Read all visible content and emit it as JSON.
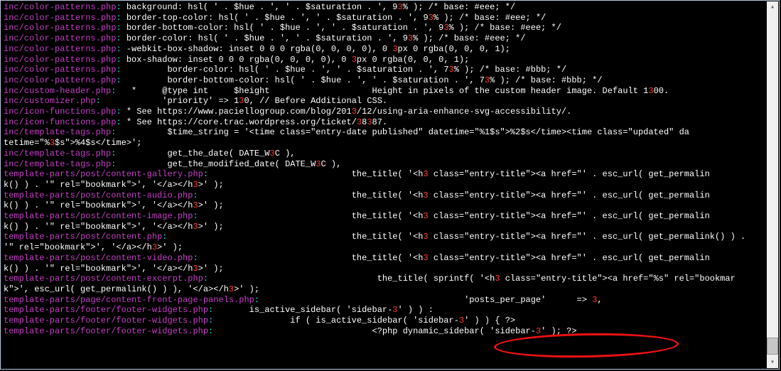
{
  "lines": [
    {
      "path": "inc/color-patterns.php",
      "segments": [
        {
          "t": " background: hsl( ' . $hue . ', ' . $saturation . ', 9"
        },
        {
          "t": "3",
          "h": true
        },
        {
          "t": "% ); /* base: #eee; */"
        }
      ]
    },
    {
      "path": "inc/color-patterns.php",
      "segments": [
        {
          "t": " border-top-color: hsl( ' . $hue . ', ' . $saturation . ', 9"
        },
        {
          "t": "3",
          "h": true
        },
        {
          "t": "% ); /* base: #eee; */"
        }
      ]
    },
    {
      "path": "inc/color-patterns.php",
      "segments": [
        {
          "t": " border-bottom-color: hsl( ' . $hue . ', ' . $saturation . ', 9"
        },
        {
          "t": "3",
          "h": true
        },
        {
          "t": "% ); /* base: #eee; */"
        }
      ]
    },
    {
      "path": "inc/color-patterns.php",
      "segments": [
        {
          "t": " border-color: hsl( ' . $hue . ', ' . $saturation . ', 9"
        },
        {
          "t": "3",
          "h": true
        },
        {
          "t": "% ); /* base: #eee; */"
        }
      ]
    },
    {
      "path": "inc/color-patterns.php",
      "segments": [
        {
          "t": " -webkit-box-shadow: inset 0 0 0 rgba(0, 0, 0, 0), 0 "
        },
        {
          "t": "3",
          "h": true
        },
        {
          "t": "px 0 rgba(0, 0, 0, 1);"
        }
      ]
    },
    {
      "path": "inc/color-patterns.php",
      "segments": [
        {
          "t": " box-shadow: inset 0 0 0 rgba(0, 0, 0, 0), 0 "
        },
        {
          "t": "3",
          "h": true
        },
        {
          "t": "px 0 rgba(0, 0, 0, 1);"
        }
      ]
    },
    {
      "path": "inc/color-patterns.php",
      "segments": [
        {
          "t": "         border-color: hsl( ' . $hue . ', ' . $saturation . ', 7"
        },
        {
          "t": "3",
          "h": true
        },
        {
          "t": "% ); /* base: #bbb; */"
        }
      ]
    },
    {
      "path": "inc/color-patterns.php",
      "segments": [
        {
          "t": "         border-bottom-color: hsl( ' . $hue . ', ' . $saturation . ', 7"
        },
        {
          "t": "3",
          "h": true
        },
        {
          "t": "% ); /* base: #bbb; */"
        }
      ]
    },
    {
      "path": "inc/custom-header.php",
      "segments": [
        {
          "t": "   *     @type int     $height                    Height in pixels of the custom header image. Default 1"
        },
        {
          "t": "3",
          "h": true
        },
        {
          "t": "00."
        }
      ]
    },
    {
      "path": "inc/customizer.php",
      "segments": [
        {
          "t": "            'priority' => 1"
        },
        {
          "t": "3",
          "h": true
        },
        {
          "t": "0, // Before Additional CSS."
        }
      ]
    },
    {
      "path": "inc/icon-functions.php",
      "segments": [
        {
          "t": " * See https://www.paciellogroup.com/blog/201"
        },
        {
          "t": "3",
          "h": true
        },
        {
          "t": "/12/using-aria-enhance-svg-accessibility/."
        }
      ]
    },
    {
      "path": "inc/icon-functions.php",
      "segments": [
        {
          "t": " * See https://core.trac.wordpress.org/ticket/"
        },
        {
          "t": "3",
          "h": true
        },
        {
          "t": "8"
        },
        {
          "t": "3",
          "h": true
        },
        {
          "t": "87."
        }
      ]
    },
    {
      "path": "inc/template-tags.php",
      "segments": [
        {
          "t": "          $time_string = '<time class=\"entry-date published\" datetime=\"%1$s\">%2$s</time><time class=\"updated\" da"
        }
      ]
    },
    {
      "cont": true,
      "segments": [
        {
          "t": "tetime=\"%"
        },
        {
          "t": "3",
          "h": true
        },
        {
          "t": "$s\">%4$s</time>';"
        }
      ]
    },
    {
      "path": "inc/template-tags.php",
      "segments": [
        {
          "t": "          get_the_date( DATE_W"
        },
        {
          "t": "3",
          "h": true
        },
        {
          "t": "C ),"
        }
      ]
    },
    {
      "path": "inc/template-tags.php",
      "segments": [
        {
          "t": "          get_the_modified_date( DATE_W"
        },
        {
          "t": "3",
          "h": true
        },
        {
          "t": "C ),"
        }
      ]
    },
    {
      "path": "template-parts/post/content-gallery.php",
      "segments": [
        {
          "t": "                            the_title( '<h"
        },
        {
          "t": "3",
          "h": true
        },
        {
          "t": " class=\"entry-title\"><a href=\"' . esc_url( get_permalin"
        }
      ]
    },
    {
      "cont": true,
      "segments": [
        {
          "t": "k() ) . '\" rel=\"bookmark\">', '</a></h"
        },
        {
          "t": "3",
          "h": true
        },
        {
          "t": ">' );"
        }
      ]
    },
    {
      "path": "template-parts/post/content-audio.php",
      "segments": [
        {
          "t": "                              the_title( '<h"
        },
        {
          "t": "3",
          "h": true
        },
        {
          "t": " class=\"entry-title\"><a href=\"' . esc_url( get_permalin"
        }
      ]
    },
    {
      "cont": true,
      "segments": [
        {
          "t": "k() ) . '\" rel=\"bookmark\">', '</a></h"
        },
        {
          "t": "3",
          "h": true
        },
        {
          "t": ">' );"
        }
      ]
    },
    {
      "path": "template-parts/post/content-image.php",
      "segments": [
        {
          "t": "                              the_title( '<h"
        },
        {
          "t": "3",
          "h": true
        },
        {
          "t": " class=\"entry-title\"><a href=\"' . esc_url( get_permalin"
        }
      ]
    },
    {
      "cont": true,
      "segments": [
        {
          "t": "k() ) . '\" rel=\"bookmark\">', '</a></h"
        },
        {
          "t": "3",
          "h": true
        },
        {
          "t": ">' );"
        }
      ]
    },
    {
      "path": "template-parts/post/content.php",
      "segments": [
        {
          "t": "                                    the_title( '<h"
        },
        {
          "t": "3",
          "h": true
        },
        {
          "t": " class=\"entry-title\"><a href=\"' . esc_url( get_permalink() ) . "
        }
      ]
    },
    {
      "cont": true,
      "segments": [
        {
          "t": "'\" rel=\"bookmark\">', '</a></h"
        },
        {
          "t": "3",
          "h": true
        },
        {
          "t": ">' );"
        }
      ]
    },
    {
      "path": "template-parts/post/content-video.php",
      "segments": [
        {
          "t": "                              the_title( '<h"
        },
        {
          "t": "3",
          "h": true
        },
        {
          "t": " class=\"entry-title\"><a href=\"' . esc_url( get_permalin"
        }
      ]
    },
    {
      "cont": true,
      "segments": [
        {
          "t": "k() ) . '\" rel=\"bookmark\">', '</a></h"
        },
        {
          "t": "3",
          "h": true
        },
        {
          "t": ">' );"
        }
      ]
    },
    {
      "path": "template-parts/post/content-excerpt.php",
      "segments": [
        {
          "t": "                                 the_title( sprintf( '<h"
        },
        {
          "t": "3",
          "h": true
        },
        {
          "t": " class=\"entry-title\"><a href=\"%s\" rel=\"bookmar"
        }
      ]
    },
    {
      "cont": true,
      "segments": [
        {
          "t": "k\">', esc_url( get_permalink() ) ), '</a></h"
        },
        {
          "t": "3",
          "h": true
        },
        {
          "t": ">' );"
        }
      ]
    },
    {
      "path": "template-parts/page/content-front-page-panels.php",
      "segments": [
        {
          "t": "                                        'posts_per_page'      => "
        },
        {
          "t": "3",
          "h": true
        },
        {
          "t": ","
        }
      ]
    },
    {
      "path": "template-parts/footer/footer-widgets.php",
      "segments": [
        {
          "t": "       is_active_sidebar( 'sidebar-"
        },
        {
          "t": "3",
          "h": true
        },
        {
          "t": "' ) ) :"
        }
      ]
    },
    {
      "path": "template-parts/footer/footer-widgets.php",
      "segments": [
        {
          "t": "               if ( is_active_sidebar( 'sidebar-"
        },
        {
          "t": "3",
          "h": true
        },
        {
          "t": "' ) ) { ?>"
        }
      ]
    },
    {
      "path": "template-parts/footer/footer-widgets.php",
      "segments": [
        {
          "t": "                               <?php dynamic_sidebar( 'sidebar-"
        },
        {
          "t": "3",
          "h": true
        },
        {
          "t": "' ); ?>"
        }
      ]
    }
  ]
}
